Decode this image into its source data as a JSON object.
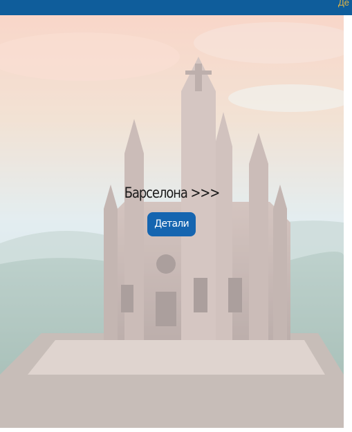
{
  "header": {
    "background_color": "#0f5d9b",
    "link_fragment": "Де",
    "link_color": "#e0b445"
  },
  "hero": {
    "image_subject": "Temple on a hilltop above a city at sunset",
    "title": "Барселона >>>",
    "button_label": "Детали",
    "button_color": "#1565b0"
  }
}
